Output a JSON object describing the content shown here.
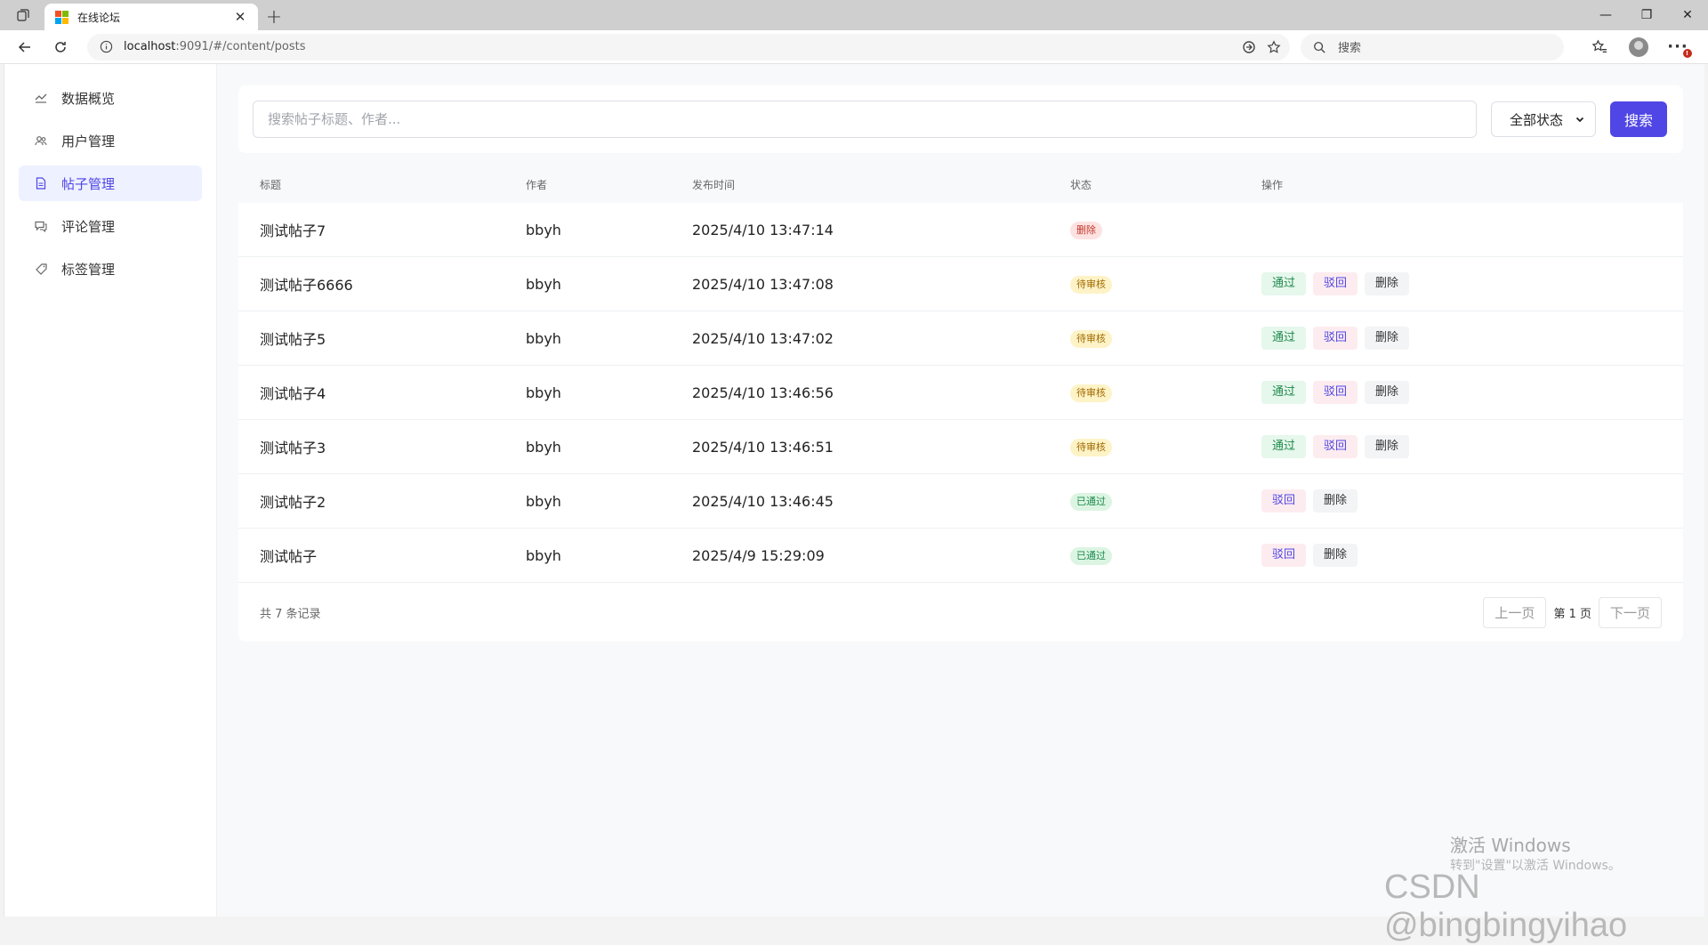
{
  "browser": {
    "tab_title": "在线论坛",
    "url_host": "localhost",
    "url_path": ":9091/#/content/posts",
    "search_placeholder": "搜索"
  },
  "sidebar": {
    "items": [
      {
        "label": "数据概览",
        "icon": "chart-trend-icon"
      },
      {
        "label": "用户管理",
        "icon": "users-icon"
      },
      {
        "label": "帖子管理",
        "icon": "document-icon",
        "active": true
      },
      {
        "label": "评论管理",
        "icon": "comment-icon"
      },
      {
        "label": "标签管理",
        "icon": "tag-icon"
      }
    ]
  },
  "search": {
    "placeholder": "搜索帖子标题、作者...",
    "status_selected": "全部状态",
    "button_label": "搜索"
  },
  "table": {
    "headers": {
      "title": "标题",
      "author": "作者",
      "time": "发布时间",
      "status": "状态",
      "ops": "操作"
    },
    "rows": [
      {
        "title": "测试帖子7",
        "author": "bbyh",
        "time": "2025/4/10 13:47:14",
        "status": "删除",
        "status_type": "deleted",
        "ops": []
      },
      {
        "title": "测试帖子6666",
        "author": "bbyh",
        "time": "2025/4/10 13:47:08",
        "status": "待审核",
        "status_type": "pending",
        "ops": [
          "通过",
          "驳回",
          "删除"
        ]
      },
      {
        "title": "测试帖子5",
        "author": "bbyh",
        "time": "2025/4/10 13:47:02",
        "status": "待审核",
        "status_type": "pending",
        "ops": [
          "通过",
          "驳回",
          "删除"
        ]
      },
      {
        "title": "测试帖子4",
        "author": "bbyh",
        "time": "2025/4/10 13:46:56",
        "status": "待审核",
        "status_type": "pending",
        "ops": [
          "通过",
          "驳回",
          "删除"
        ]
      },
      {
        "title": "测试帖子3",
        "author": "bbyh",
        "time": "2025/4/10 13:46:51",
        "status": "待审核",
        "status_type": "pending",
        "ops": [
          "通过",
          "驳回",
          "删除"
        ]
      },
      {
        "title": "测试帖子2",
        "author": "bbyh",
        "time": "2025/4/10 13:46:45",
        "status": "已通过",
        "status_type": "approved",
        "ops": [
          "驳回",
          "删除"
        ]
      },
      {
        "title": "测试帖子",
        "author": "bbyh",
        "time": "2025/4/9 15:29:09",
        "status": "已通过",
        "status_type": "approved",
        "ops": [
          "驳回",
          "删除"
        ]
      }
    ]
  },
  "footer": {
    "total_text": "共 7 条记录",
    "prev_label": "上一页",
    "page_info": "第 1 页",
    "next_label": "下一页"
  },
  "watermarks": {
    "windows_title": "激活 Windows",
    "windows_sub": "转到\"设置\"以激活 Windows。",
    "csdn": "CSDN @bingbingyihao"
  },
  "colors": {
    "accent": "#4f46e5",
    "approve": "#1e8a4c",
    "deleted": "#c0392b",
    "pending": "#a06a00"
  }
}
